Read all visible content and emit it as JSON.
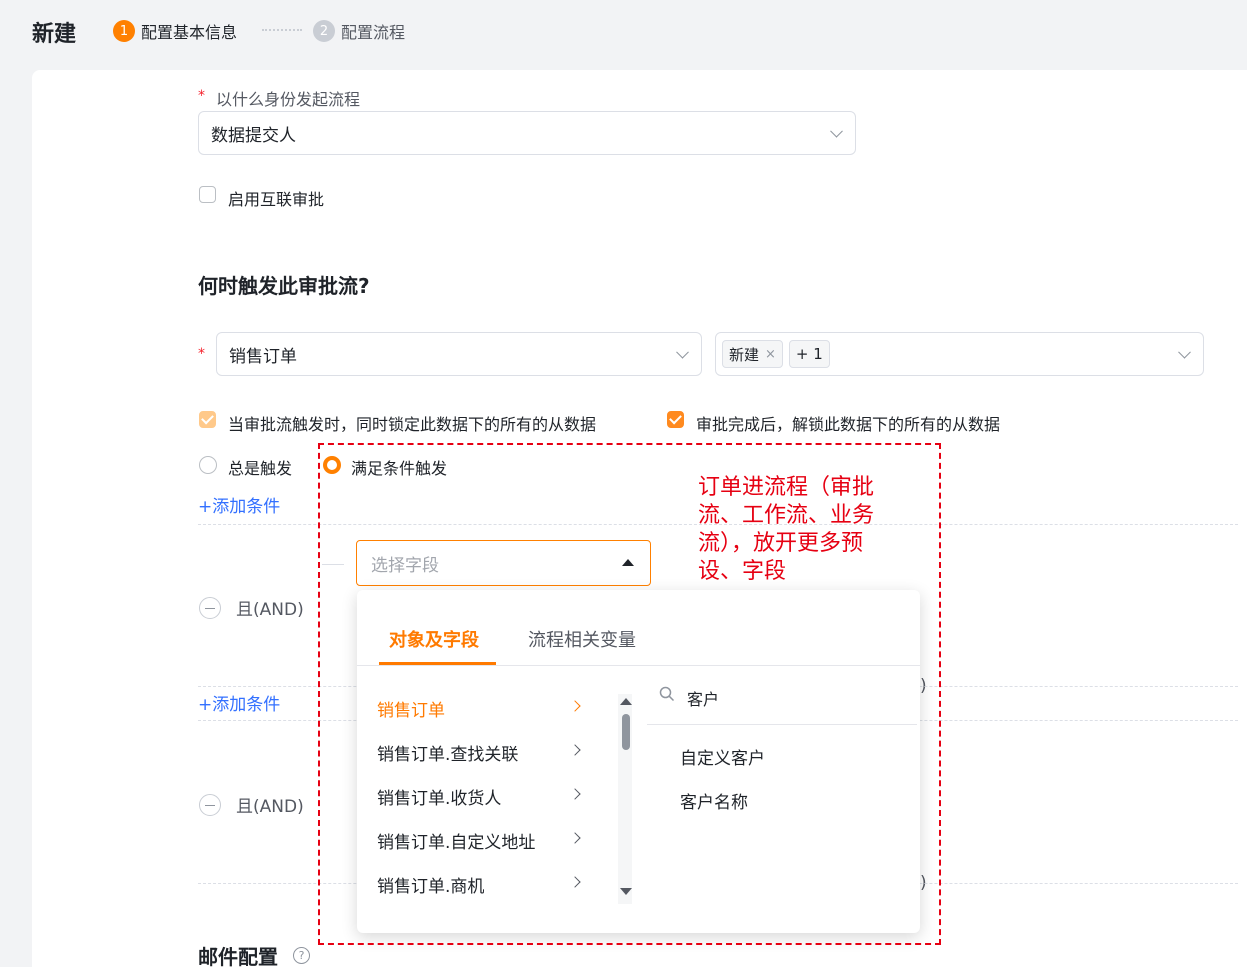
{
  "header": {
    "title": "新建",
    "steps": [
      {
        "num": "1",
        "label": "配置基本信息"
      },
      {
        "num": "2",
        "label": "配置流程"
      }
    ]
  },
  "initiator": {
    "label": "以什么身份发起流程",
    "required_mark": "*",
    "value": "数据提交人"
  },
  "interconnect": {
    "label": "启用互联审批",
    "checked": false
  },
  "trigger": {
    "title": "何时触发此审批流?",
    "required_mark": "*",
    "object_value": "销售订单",
    "tags": [
      {
        "label": "新建",
        "close": "×"
      }
    ],
    "more_count": "+ 1",
    "lock_option": {
      "label": "当审批流触发时，同时锁定此数据下的所有的从数据",
      "checked": true
    },
    "unlock_option": {
      "label": "审批完成后，解锁此数据下的所有的从数据",
      "checked": true
    },
    "always_label": "总是触发",
    "condition_label": "满足条件触发",
    "add_condition": "+添加条件",
    "add_condition_2": "+添加条件",
    "and_label": "且(AND)",
    "and_label_2": "且(AND)",
    "peek_1": ")",
    "peek_2": ")"
  },
  "field_picker": {
    "placeholder": "选择字段",
    "tabs": [
      "对象及字段",
      "流程相关变量"
    ],
    "objects": [
      "销售订单",
      "销售订单.查找关联",
      "销售订单.收货人",
      "销售订单.自定义地址",
      "销售订单.商机"
    ],
    "search_value": "客户",
    "results": [
      "自定义客户",
      "客户名称"
    ]
  },
  "annotation": "订单进流程（审批流、工作流、业务流），放开更多预设、字段",
  "email": {
    "title": "邮件配置",
    "help": "?"
  },
  "colors": {
    "accent": "#ff8000",
    "link": "#3370ff",
    "annotation": "#e60012"
  }
}
